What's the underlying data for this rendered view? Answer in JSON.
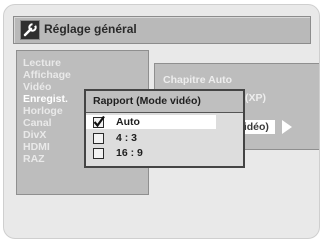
{
  "header": {
    "title": "Réglage général",
    "icon": "wrench-icon"
  },
  "menu": {
    "items": [
      {
        "label": "Lecture"
      },
      {
        "label": "Affichage"
      },
      {
        "label": "Vidéo"
      },
      {
        "label": "Enregist."
      },
      {
        "label": "Horloge"
      },
      {
        "label": "Canal"
      },
      {
        "label": "DivX"
      },
      {
        "label": "HDMI"
      },
      {
        "label": "RAZ"
      }
    ],
    "selected": "Enregist."
  },
  "settings_panel": {
    "chapitre_auto": "Chapitre Auto",
    "xp_fragment": "(XP)",
    "highlighted_fragment": "vidéo)"
  },
  "popup": {
    "title": "Rapport (Mode vidéo)",
    "options": [
      {
        "label": "Auto",
        "checked": true
      },
      {
        "label": "4 : 3",
        "checked": false
      },
      {
        "label": "16 : 9",
        "checked": false
      }
    ]
  }
}
